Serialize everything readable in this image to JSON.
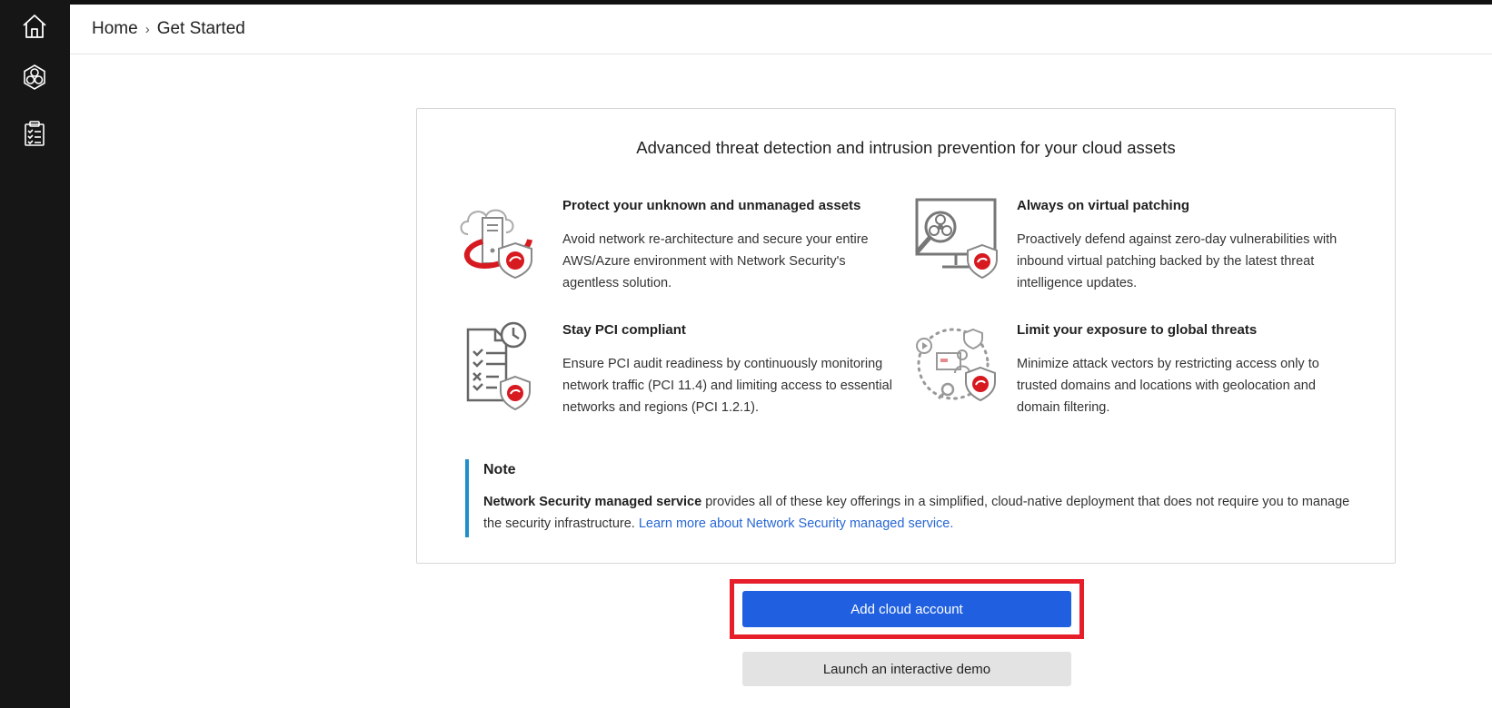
{
  "breadcrumb": {
    "home": "Home",
    "separator": "›",
    "current": "Get Started"
  },
  "sidebar": {
    "items": [
      {
        "icon": "home-icon"
      },
      {
        "icon": "hexagon-network-icon"
      },
      {
        "icon": "clipboard-checklist-icon"
      }
    ]
  },
  "card": {
    "title": "Advanced threat detection and intrusion prevention for your cloud assets",
    "features": [
      {
        "title": "Protect your unknown and unmanaged assets",
        "description": "Avoid network re-architecture and secure your entire AWS/Azure environment with Network Security's agentless solution.",
        "icon": "cloud-server-shield-icon"
      },
      {
        "title": "Always on virtual patching",
        "description": "Proactively defend against zero-day vulnerabilities with inbound virtual patching backed by the latest threat intelligence updates.",
        "icon": "monitor-biohazard-shield-icon"
      },
      {
        "title": "Stay PCI compliant",
        "description": "Ensure PCI audit readiness by continuously monitoring network traffic (PCI 11.4) and limiting access to essential networks and regions (PCI 1.2.1).",
        "icon": "checklist-clock-shield-icon"
      },
      {
        "title": "Limit your exposure to global threats",
        "description": "Minimize attack vectors by restricting access only to trusted domains and locations with geolocation and domain filtering.",
        "icon": "global-threat-cycle-shield-icon"
      }
    ],
    "note": {
      "title": "Note",
      "bold_text": "Network Security managed service",
      "text": " provides all of these key offerings in a simplified, cloud-native deployment that does not require you to manage the security infrastructure. ",
      "link_text": "Learn more about Network Security managed service."
    }
  },
  "actions": {
    "add_cloud_account": "Add cloud account",
    "launch_demo": "Launch an interactive demo"
  },
  "colors": {
    "primary": "#1f5fe0",
    "highlight": "#e61e2a",
    "note_accent": "#1e8fc9",
    "brand_red": "#d71920",
    "sidebar": "#161616"
  }
}
